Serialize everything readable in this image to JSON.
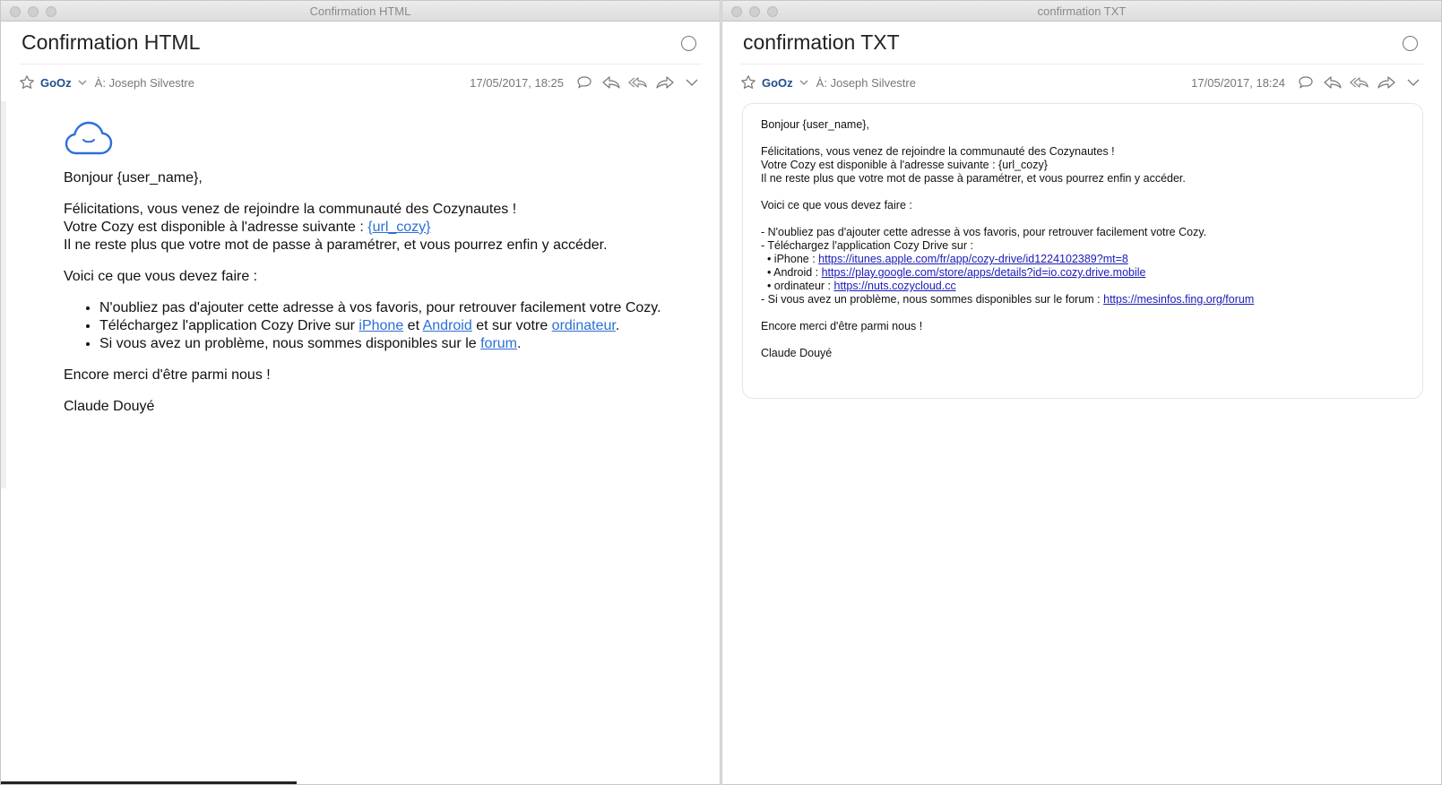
{
  "left_window": {
    "window_title": "Confirmation HTML",
    "subject": "Confirmation HTML",
    "sender": "GoOz",
    "recipient_prefix": "À:",
    "recipient": "Joseph Silvestre",
    "date": "17/05/2017, 18:25",
    "body": {
      "greeting": "Bonjour {user_name},",
      "congrats": "Félicitations, vous venez de rejoindre la communauté des Cozynautes !",
      "address_text": "Votre Cozy est disponible à l'adresse suivante : ",
      "address_link": "{url_cozy}",
      "remaining": "Il ne reste plus que votre mot de passe à paramétrer, et vous pourrez enfin y accéder.",
      "todo_intro": "Voici ce que vous devez faire :",
      "bullet1": "N'oubliez pas d'ajouter cette adresse à vos favoris, pour retrouver facilement votre Cozy.",
      "bullet2_pre": "Téléchargez l'application Cozy Drive sur ",
      "bullet2_link_iphone": "iPhone",
      "bullet2_mid1": " et ",
      "bullet2_link_android": "Android",
      "bullet2_mid2": " et sur votre ",
      "bullet2_link_ordinateur": "ordinateur",
      "bullet2_end": ".",
      "bullet3_pre": "Si vous avez un problème, nous sommes disponibles sur le ",
      "bullet3_link_forum": "forum",
      "bullet3_end": ".",
      "thanks": "Encore merci d'être parmi nous !",
      "signature": "Claude Douyé"
    }
  },
  "right_window": {
    "window_title": "confirmation TXT",
    "subject": "confirmation TXT",
    "sender": "GoOz",
    "recipient_prefix": "À:",
    "recipient": "Joseph Silvestre",
    "date": "17/05/2017, 18:24",
    "body": {
      "greeting": "Bonjour {user_name},",
      "congrats": "Félicitations, vous venez de rejoindre la communauté des Cozynautes !",
      "address": "Votre Cozy est disponible à l'adresse suivante : {url_cozy}",
      "remaining": "Il ne reste plus que votre mot de passe à paramétrer, et vous pourrez enfin y accéder.",
      "todo_intro": "Voici ce que vous devez faire :",
      "line_favoris": "- N'oubliez pas d'ajouter cette adresse à vos favoris, pour retrouver facilement votre Cozy.",
      "line_download": "- Téléchargez l'application Cozy Drive sur :",
      "iphone_label": "  • iPhone : ",
      "iphone_url": "https://itunes.apple.com/fr/app/cozy-drive/id1224102389?mt=8",
      "android_label": "  • Android : ",
      "android_url": "https://play.google.com/store/apps/details?id=io.cozy.drive.mobile",
      "ordinateur_label": "  • ordinateur : ",
      "ordinateur_url": "https://nuts.cozycloud.cc",
      "forum_label": "- Si vous avez un problème, nous sommes disponibles sur le forum : ",
      "forum_url": "https://mesinfos.fing.org/forum",
      "thanks": "Encore merci d'être parmi nous !",
      "signature": "Claude Douyé"
    }
  },
  "icons": [
    "star-icon",
    "chevron-down-icon",
    "comment-icon",
    "reply-icon",
    "reply-all-icon",
    "forward-icon",
    "more-chevron-icon",
    "status-circle-icon",
    "cozy-cloud-logo"
  ],
  "colors": {
    "link_html": "#2b6fd6",
    "link_txt": "#1a1ab8",
    "sender": "#1f4e8c",
    "meta": "#777777"
  }
}
